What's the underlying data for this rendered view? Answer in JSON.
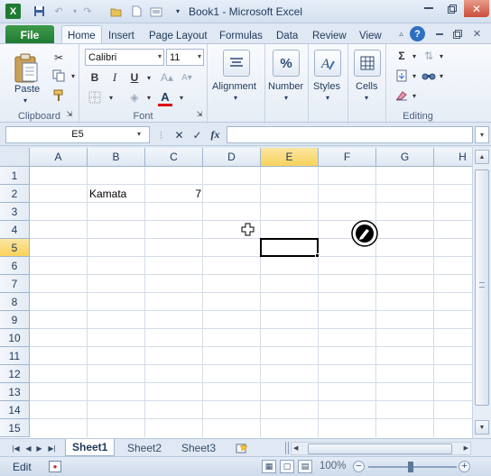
{
  "window": {
    "title": "Book1 - Microsoft Excel",
    "app_icon": "X"
  },
  "ribbon_tabs": {
    "file": "File",
    "home": "Home",
    "insert": "Insert",
    "page_layout": "Page Layout",
    "formulas": "Formulas",
    "data": "Data",
    "review": "Review",
    "view": "View"
  },
  "ribbon": {
    "clipboard": {
      "label": "Clipboard",
      "paste": "Paste"
    },
    "font": {
      "label": "Font",
      "name": "Calibri",
      "size": "11",
      "bold": "B",
      "italic": "I",
      "underline": "U",
      "font_color": "A",
      "font_color_bar": "#e00000"
    },
    "alignment": {
      "label": "Alignment"
    },
    "number": {
      "label": "Number",
      "icon": "%"
    },
    "styles": {
      "label": "Styles"
    },
    "cells": {
      "label": "Cells"
    },
    "editing": {
      "label": "Editing"
    }
  },
  "formula_bar": {
    "name_box": "E5",
    "value": ""
  },
  "grid": {
    "columns": [
      "A",
      "B",
      "C",
      "D",
      "E",
      "F",
      "G",
      "H"
    ],
    "rows": [
      "1",
      "2",
      "3",
      "4",
      "5",
      "6",
      "7",
      "8",
      "9",
      "10",
      "11",
      "12",
      "13",
      "14",
      "15"
    ],
    "selected_column": "E",
    "selected_row": "5",
    "cells": {
      "B2": "Kamata",
      "C2": "7"
    }
  },
  "sheet_tabs": [
    "Sheet1",
    "Sheet2",
    "Sheet3"
  ],
  "status": {
    "mode": "Edit",
    "zoom": "100%"
  },
  "colors": {
    "file_tab": "#1f7a32",
    "selection_header": "#f9d35c"
  }
}
